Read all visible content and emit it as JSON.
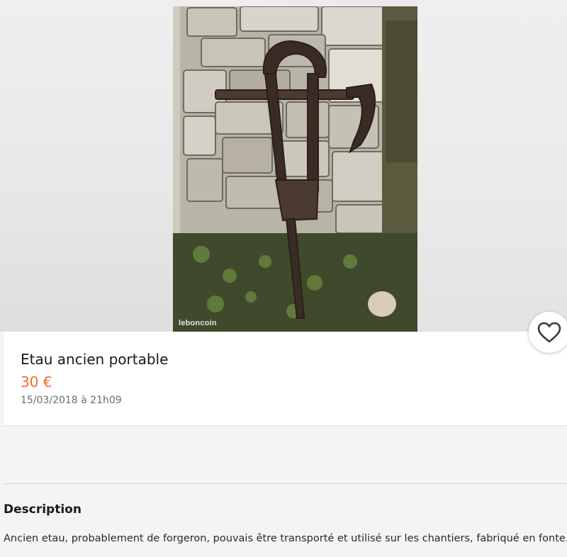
{
  "listing": {
    "title": "Etau ancien portable",
    "price": "30 €",
    "date": "15/03/2018 à 21h09",
    "image_watermark": "leboncoin",
    "favorite_icon": "heart-outline-icon"
  },
  "description": {
    "heading": "Description",
    "text": "Ancien etau, probablement de forgeron, pouvais être transporté et utilisé sur les chantiers, fabriqué en fonte."
  },
  "colors": {
    "price": "#f56b2a",
    "title": "#1a1a1a",
    "date": "#6d6d6d",
    "background": "#f4f4f4",
    "card": "#ffffff"
  }
}
